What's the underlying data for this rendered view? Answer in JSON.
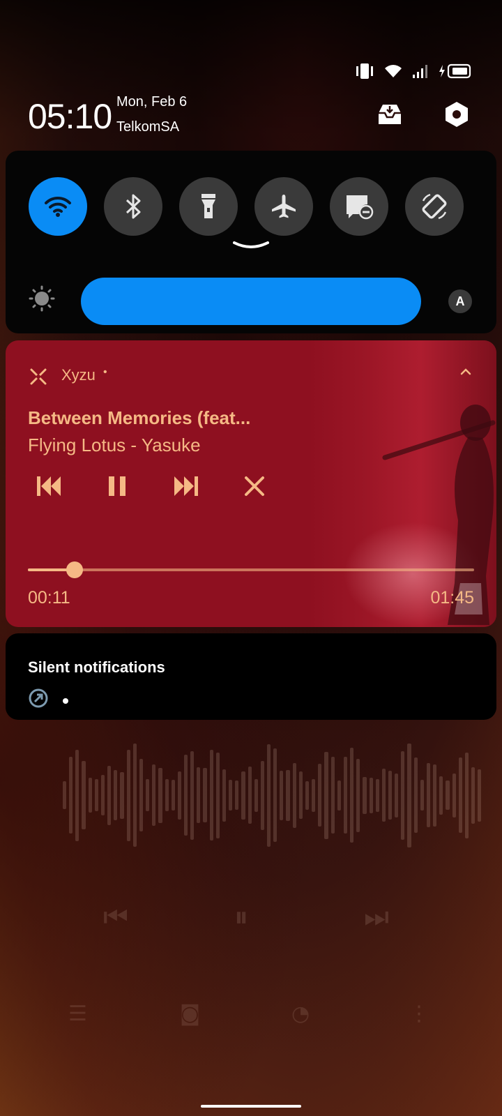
{
  "status_bar": {
    "icons": [
      "vibrate-icon",
      "wifi-icon",
      "signal-icon",
      "battery-charging-icon"
    ]
  },
  "header": {
    "time": "05:10",
    "date": "Mon, Feb 6",
    "carrier": "TelkomSA",
    "actions": [
      "notification-inbox-icon",
      "settings-icon"
    ]
  },
  "quick_settings": {
    "tiles": [
      {
        "name": "wifi",
        "icon": "wifi-icon",
        "active": true
      },
      {
        "name": "bluetooth",
        "icon": "bluetooth-icon",
        "active": false
      },
      {
        "name": "flashlight",
        "icon": "flashlight-icon",
        "active": false
      },
      {
        "name": "airplane-mode",
        "icon": "airplane-icon",
        "active": false
      },
      {
        "name": "do-not-disturb",
        "icon": "dnd-icon",
        "active": false
      },
      {
        "name": "auto-rotate",
        "icon": "rotate-icon",
        "active": false
      }
    ],
    "brightness_level": 1.0,
    "auto_brightness_label": "A"
  },
  "media": {
    "app_name": "Xyzu",
    "app_separator": "•",
    "title": "Between Memories (feat...",
    "artist": "Flying Lotus - Yasuke",
    "elapsed": "00:11",
    "total": "01:45",
    "progress": 0.105,
    "colors": {
      "card": "#8e1020",
      "accent": "#f5b985"
    }
  },
  "silent_notifications": {
    "title": "Silent notifications"
  },
  "colors": {
    "accent_blue": "#0a8cf5",
    "tile_off": "#3a3a3a"
  }
}
